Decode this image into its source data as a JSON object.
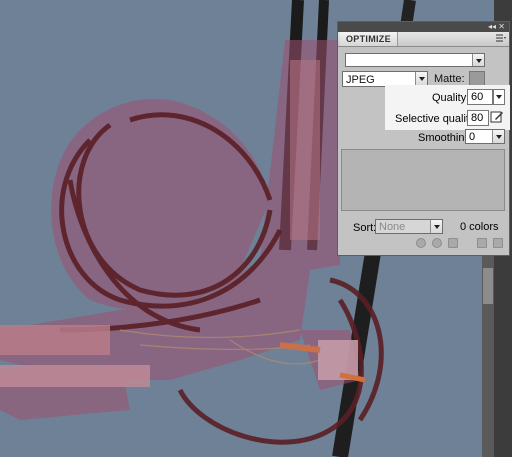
{
  "panel": {
    "tab_title": "OPTIMIZE",
    "preset_value": "",
    "format": {
      "value": "JPEG"
    },
    "matte": {
      "label": "Matte:"
    },
    "quality": {
      "label": "Quality:",
      "value": "60"
    },
    "selective_quality": {
      "label": "Selective quality:",
      "value": "80"
    },
    "smoothing": {
      "label": "Smoothing:",
      "value": "0"
    },
    "sort": {
      "label": "Sort:",
      "value": "None"
    },
    "colors_count": "0 colors"
  },
  "colors": {
    "canvas_bg": "#6f8196",
    "wire_mask": "#9e5070",
    "panel_bg": "#c3c3c3"
  }
}
